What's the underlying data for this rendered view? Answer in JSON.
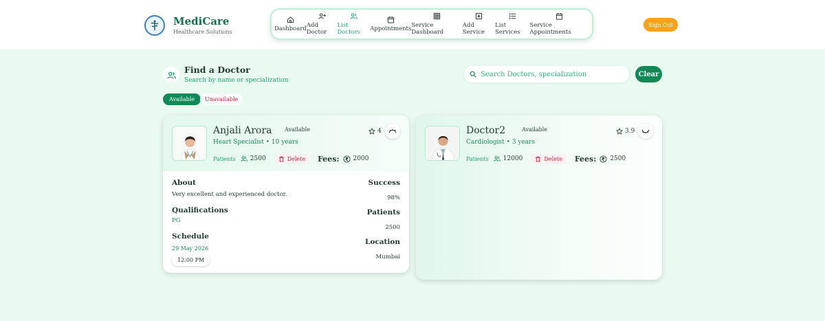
{
  "brand": {
    "name": "MediCare",
    "tagline": "Healthcare Solutions"
  },
  "nav": {
    "items": [
      {
        "label": "Dashboard",
        "icon": "home-icon"
      },
      {
        "label": "Add Doctor",
        "icon": "user-plus-icon"
      },
      {
        "label": "List Doctors",
        "icon": "users-icon",
        "active": true
      },
      {
        "label": "Appointments",
        "icon": "calendar-icon"
      },
      {
        "label": "Service Dashboard",
        "icon": "grid-icon"
      },
      {
        "label": "Add Service",
        "icon": "plus-square-icon"
      },
      {
        "label": "List Services",
        "icon": "list-icon"
      },
      {
        "label": "Service Appointments",
        "icon": "calendar-icon"
      }
    ],
    "active_color": "#1fa86c"
  },
  "header": {
    "signout_label": "Sign Out",
    "signout_color": "#f7a21b"
  },
  "find": {
    "title": "Find a Doctor",
    "subtitle": "Search by name or specialization"
  },
  "search": {
    "placeholder": "Search Doctors, specialization",
    "value": "",
    "clear_label": "Clear"
  },
  "filters": {
    "available_label": "Available",
    "unavailable_label": "Unavailable"
  },
  "doctors": [
    {
      "name": "Anjali Arora",
      "status": "Available",
      "specialization": "Heart Specialist • 10 years",
      "patients_label": "Patients",
      "patients": "2500",
      "delete_label": "Delete",
      "fees_label": "Fees:",
      "fees": "2000",
      "rating": "4",
      "expanded": true,
      "about_title": "About",
      "about": "Very excellent and experienced doctor.",
      "qualifications_title": "Qualifications",
      "qualifications": "PG",
      "schedule_title": "Schedule",
      "schedule_date": "29 May 2026",
      "schedule_time": "12:00 PM",
      "success_title": "Success",
      "success": "98%",
      "patients_title": "Patients",
      "patients_count": "2500",
      "location_title": "Location",
      "location": "Mumbai"
    },
    {
      "name": "Doctor2",
      "status": "Available",
      "specialization": "Cardiologist • 3 years",
      "patients_label": "Patients",
      "patients": "12000",
      "delete_label": "Delete",
      "fees_label": "Fees:",
      "fees": "2500",
      "rating": "3.9",
      "expanded": false
    }
  ]
}
